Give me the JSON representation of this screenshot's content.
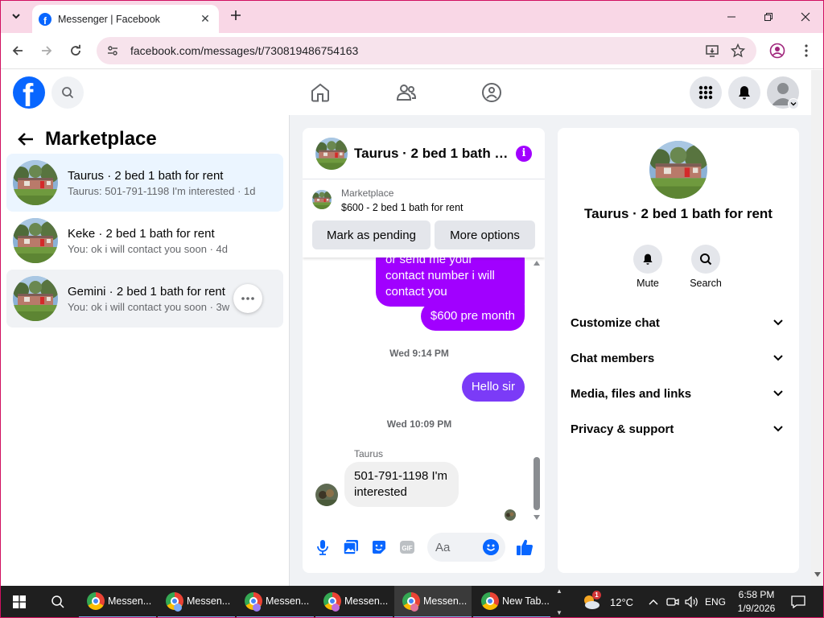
{
  "browser": {
    "tab_title": "Messenger | Facebook",
    "url": "facebook.com/messages/t/730819486754163"
  },
  "left_panel": {
    "title": "Marketplace",
    "conversations": [
      {
        "name": "Taurus · 2 bed 1 bath for rent",
        "preview": "Taurus: 501-791-1198 I'm interested · 1d",
        "state": "selected"
      },
      {
        "name": "Keke · 2 bed 1 bath for rent",
        "preview": "You: ok i will contact you soon · 4d",
        "state": "normal"
      },
      {
        "name": "Gemini · 2 bed 1 bath for rent",
        "preview": "You: ok i will contact you soon · 3w",
        "state": "hovered"
      }
    ]
  },
  "chat": {
    "title": "Taurus · 2 bed 1 bath …",
    "listing": {
      "label": "Marketplace",
      "price": "$600 - 2 bed 1 bath for rent",
      "btn_pending": "Mark as pending",
      "btn_more": "More options"
    },
    "messages": {
      "partial_line": "or send me your",
      "out1_line1": "contact number i will",
      "out1_line2": "contact you",
      "out2": "$600 pre month",
      "ts1": "Wed 9:14 PM",
      "out3": "Hello sir",
      "ts2": "Wed 10:09 PM",
      "sender": "Taurus",
      "in1_line1": "501-791-1198 I'm",
      "in1_line2": "interested"
    },
    "composer_placeholder": "Aa"
  },
  "right_panel": {
    "title": "Taurus · 2 bed 1 bath for rent",
    "mute_label": "Mute",
    "search_label": "Search",
    "sections": [
      "Customize chat",
      "Chat members",
      "Media, files and links",
      "Privacy & support"
    ]
  },
  "taskbar": {
    "apps": [
      "Messen...",
      "Messen...",
      "Messen...",
      "Messen...",
      "Messen...",
      "New Tab..."
    ],
    "weather_badge": "1",
    "temperature": "12°C",
    "language": "ENG",
    "time": "6:58 PM",
    "date": "1/9/2026"
  },
  "colors": {
    "fb_blue": "#0866ff",
    "bubble_purple": "#a100ff",
    "bubble_violet": "#7b3bf7",
    "selected_bg": "#ebf5ff"
  }
}
